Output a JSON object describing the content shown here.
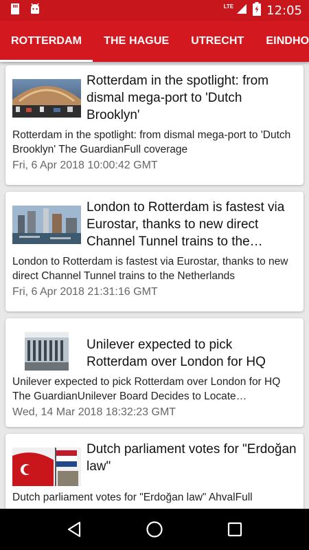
{
  "status_bar": {
    "time": "12:05",
    "network": "LTE",
    "icons": [
      "sim-card-icon",
      "android-icon",
      "signal-icon",
      "battery-icon"
    ]
  },
  "tabs": [
    {
      "label": "ROTTERDAM",
      "active": true
    },
    {
      "label": "THE HAGUE",
      "active": false
    },
    {
      "label": "UTRECHT",
      "active": false
    },
    {
      "label": "EINDHOV",
      "active": false
    }
  ],
  "articles": [
    {
      "title": "Rotterdam in the spotlight: from dismal mega-port to 'Dutch Brooklyn'",
      "description": "Rotterdam in the spotlight: from dismal mega-port to 'Dutch Brooklyn'  The GuardianFull coverage",
      "date": "Fri, 6 Apr 2018 10:00:42 GMT"
    },
    {
      "title": "London to Rotterdam is fastest via Eurostar, thanks to new direct Channel Tunnel trains to the Netherlands",
      "description": "London to Rotterdam is fastest via Eurostar, thanks to new direct Channel Tunnel trains to the Netherlands",
      "date": "Fri, 6 Apr 2018 21:31:16 GMT"
    },
    {
      "title": "Unilever expected to pick Rotterdam over London for HQ",
      "description": "Unilever expected to pick Rotterdam over London for HQ  The GuardianUnilever Board Decides to Locate Headquarters",
      "date": "Wed, 14 Mar 2018 18:32:23 GMT"
    },
    {
      "title": "Dutch parliament votes for \"Erdoğan law\"",
      "description": "Dutch parliament votes for \"Erdoğan law\"  AhvalFull coverage",
      "date": ""
    }
  ],
  "nav": {
    "back": "back-icon",
    "home": "home-icon",
    "recents": "recents-icon"
  },
  "colors": {
    "brand_red": "#d4181f",
    "status_red": "#c8161d"
  }
}
